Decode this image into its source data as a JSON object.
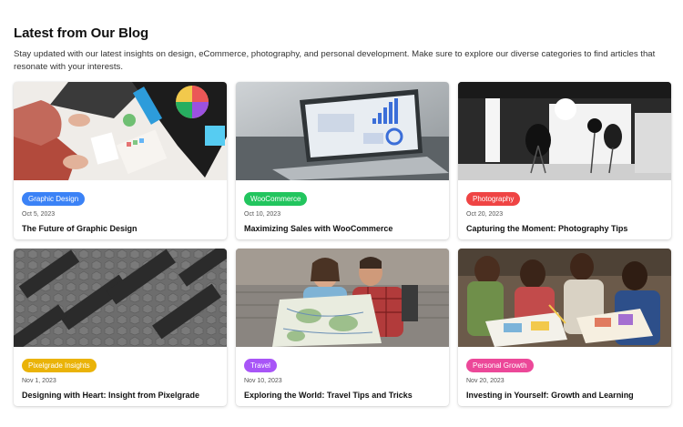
{
  "heading": "Latest from Our Blog",
  "intro": "Stay updated with our latest insights on design, eCommerce, photography, and personal development. Make sure to explore our diverse categories to find articles that resonate with your interests.",
  "posts": [
    {
      "category": "Graphic Design",
      "color": "#3b82f6",
      "date": "Oct 5, 2023",
      "title": "The Future of Graphic Design",
      "image": "designer-desk-photo"
    },
    {
      "category": "WooCommerce",
      "color": "#22c55e",
      "date": "Oct 10, 2023",
      "title": "Maximizing Sales with WooCommerce",
      "image": "laptop-analytics-photo"
    },
    {
      "category": "Photography",
      "color": "#ef4444",
      "date": "Oct 20, 2023",
      "title": "Capturing the Moment: Photography Tips",
      "image": "photo-studio-photo"
    },
    {
      "category": "Pixelgrade Insights",
      "color": "#eab308",
      "date": "Nov 1, 2023",
      "title": "Designing with Heart: Insight from Pixelgrade",
      "image": "keyboards-pattern-photo"
    },
    {
      "category": "Travel",
      "color": "#a855f7",
      "date": "Nov 10, 2023",
      "title": "Exploring the World: Travel Tips and Tricks",
      "image": "travelers-map-photo"
    },
    {
      "category": "Personal Growth",
      "color": "#ec4899",
      "date": "Nov 20, 2023",
      "title": "Investing in Yourself: Growth and Learning",
      "image": "kids-reading-photo"
    }
  ]
}
